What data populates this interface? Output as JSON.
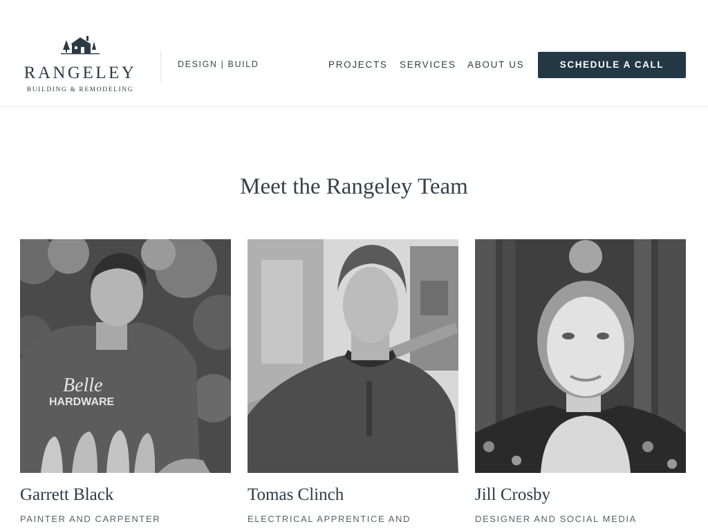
{
  "header": {
    "logo": {
      "name": "RANGELEY",
      "tagline": "BUILDING & REMODELING",
      "icon": "house-with-trees-logo"
    },
    "design_build": "DESIGN | BUILD",
    "nav": [
      {
        "label": "PROJECTS"
      },
      {
        "label": "SERVICES"
      },
      {
        "label": "ABOUT US"
      }
    ],
    "cta_label": "SCHEDULE A CALL"
  },
  "team": {
    "title": "Meet the Rangeley Team",
    "members": [
      {
        "name": "Garrett Black",
        "role": "PAINTER AND CARPENTER"
      },
      {
        "name": "Tomas Clinch",
        "role": "ELECTRICAL APPRENTICE AND"
      },
      {
        "name": "Jill Crosby",
        "role": "DESIGNER AND SOCIAL MEDIA"
      }
    ]
  },
  "colors": {
    "brand_dark": "#233744",
    "text": "#2c3a45",
    "muted": "#55626c"
  }
}
